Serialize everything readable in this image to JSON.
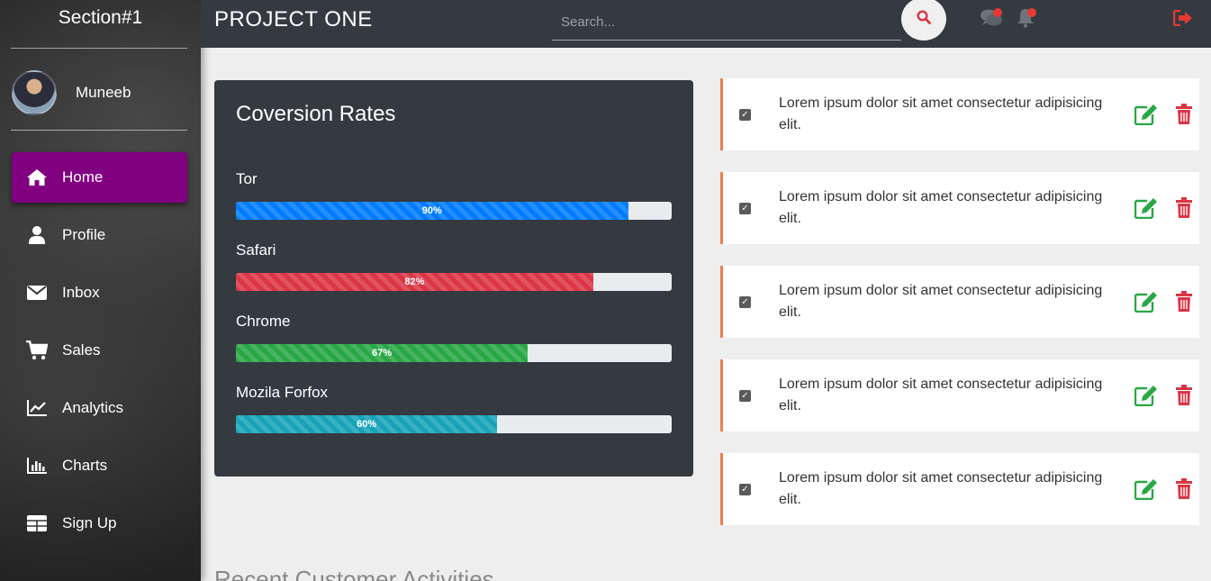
{
  "sidebar": {
    "brand": "Section#1",
    "user": {
      "name": "Muneeb"
    },
    "items": [
      {
        "label": "Home",
        "icon": "home-icon",
        "active": true
      },
      {
        "label": "Profile",
        "icon": "user-icon"
      },
      {
        "label": "Inbox",
        "icon": "envelope-icon"
      },
      {
        "label": "Sales",
        "icon": "cart-icon"
      },
      {
        "label": "Analytics",
        "icon": "line-chart-icon"
      },
      {
        "label": "Charts",
        "icon": "bar-chart-icon"
      },
      {
        "label": "Sign Up",
        "icon": "table-icon"
      }
    ]
  },
  "header": {
    "title": "PROJECT ONE",
    "search_placeholder": "Search...",
    "icons": [
      "search-icon",
      "comments-icon",
      "bell-icon",
      "sign-out-icon"
    ]
  },
  "conversion": {
    "title": "Coversion Rates",
    "bars": [
      {
        "label": "Tor",
        "value": 90,
        "text": "90%",
        "color": "#007bff"
      },
      {
        "label": "Safari",
        "value": 82,
        "text": "82%",
        "color": "#dc3545"
      },
      {
        "label": "Chrome",
        "value": 67,
        "text": "67%",
        "color": "#28a745"
      },
      {
        "label": "Mozila Forfox",
        "value": 60,
        "text": "60%",
        "color": "#17a2b8"
      }
    ]
  },
  "tasks": [
    {
      "text": "Lorem ipsum dolor sit amet consectetur adipisicing elit.",
      "checked": true
    },
    {
      "text": "Lorem ipsum dolor sit amet consectetur adipisicing elit.",
      "checked": true
    },
    {
      "text": "Lorem ipsum dolor sit amet consectetur adipisicing elit.",
      "checked": true
    },
    {
      "text": "Lorem ipsum dolor sit amet consectetur adipisicing elit.",
      "checked": true
    },
    {
      "text": "Lorem ipsum dolor sit amet consectetur adipisicing elit.",
      "checked": true
    }
  ],
  "colors": {
    "accent": "#800080",
    "task_border": "#ee7d4f",
    "edit": "#28a745",
    "delete": "#dc3545",
    "alert": "#e53935"
  },
  "sections": {
    "recent_activities": "Recent Customer Activities"
  }
}
